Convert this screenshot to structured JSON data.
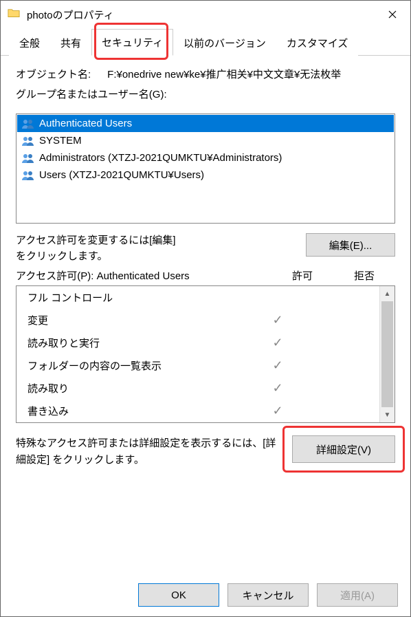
{
  "window": {
    "title": "photoのプロパティ"
  },
  "tabs": [
    {
      "label": "全般"
    },
    {
      "label": "共有"
    },
    {
      "label": "セキュリティ",
      "active": true
    },
    {
      "label": "以前のバージョン"
    },
    {
      "label": "カスタマイズ"
    }
  ],
  "object": {
    "label": "オブジェクト名:",
    "value": "F:¥onedrive new¥ke¥推广相关¥中文文章¥无法枚举"
  },
  "groups_label": "グループ名またはユーザー名(G):",
  "users": [
    {
      "name": "Authenticated Users",
      "selected": true
    },
    {
      "name": "SYSTEM"
    },
    {
      "name": "Administrators (XTZJ-2021QUMKTU¥Administrators)"
    },
    {
      "name": "Users (XTZJ-2021QUMKTU¥Users)"
    }
  ],
  "edit": {
    "text_line1": "アクセス許可を変更するには[編集]",
    "text_line2": "をクリックします。",
    "button": "編集(E)..."
  },
  "perm_header": {
    "label_prefix": "アクセス許可(P): Authenticated Users",
    "allow": "許可",
    "deny": "拒否"
  },
  "permissions": [
    {
      "name": "フル コントロール",
      "allow": false,
      "deny": false
    },
    {
      "name": "変更",
      "allow": true,
      "deny": false
    },
    {
      "name": "読み取りと実行",
      "allow": true,
      "deny": false
    },
    {
      "name": "フォルダーの内容の一覧表示",
      "allow": true,
      "deny": false
    },
    {
      "name": "読み取り",
      "allow": true,
      "deny": false
    },
    {
      "name": "書き込み",
      "allow": true,
      "deny": false
    }
  ],
  "advanced": {
    "text": "特殊なアクセス許可または詳細設定を表示するには、[詳細設定] をクリックします。",
    "button": "詳細設定(V)"
  },
  "buttons": {
    "ok": "OK",
    "cancel": "キャンセル",
    "apply": "適用(A)"
  }
}
